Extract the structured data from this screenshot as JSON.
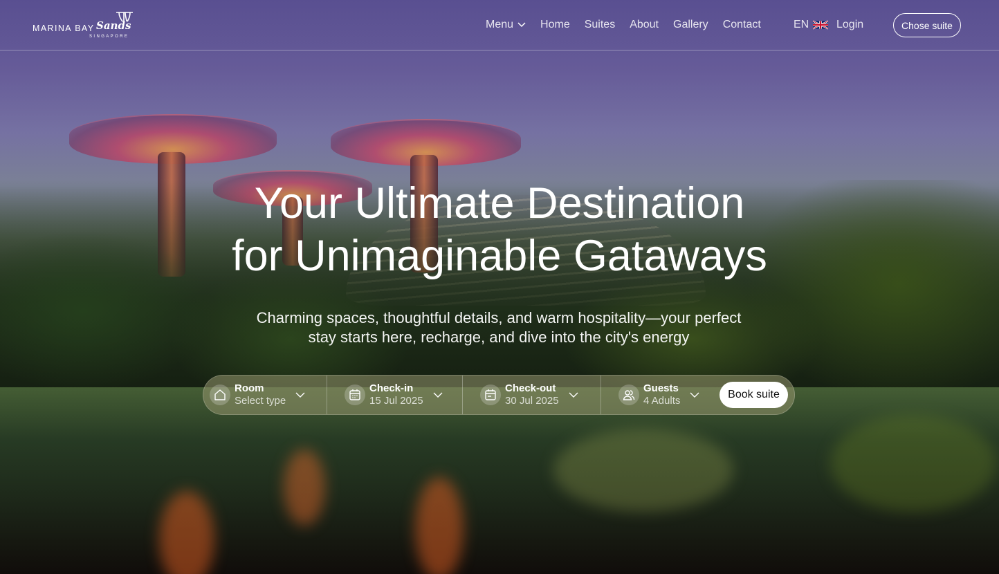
{
  "brand": {
    "name": "MARINA BAY",
    "script": "Sands",
    "location": "SINGAPORE"
  },
  "nav": {
    "items": [
      {
        "label": "Menu",
        "has_dropdown": true
      },
      {
        "label": "Home"
      },
      {
        "label": "Suites"
      },
      {
        "label": "About"
      },
      {
        "label": "Gallery"
      },
      {
        "label": "Contact"
      }
    ],
    "language": "EN",
    "login": "Login",
    "cta": "Chose suite"
  },
  "hero": {
    "title_line1": "Your Ultimate Destination",
    "title_line2": "for Unimaginable Gataways",
    "subtitle_line1": "Charming spaces, thoughtful details, and warm hospitality—your perfect",
    "subtitle_line2": "stay starts here, recharge, and dive into the city's energy"
  },
  "booking": {
    "room": {
      "label": "Room",
      "value": "Select type",
      "icon": "home-icon"
    },
    "checkin": {
      "label": "Check-in",
      "value": "15 Jul 2025",
      "icon": "calendar-icon"
    },
    "checkout": {
      "label": "Check-out",
      "value": "30 Jul 2025",
      "icon": "calendar-icon"
    },
    "guests": {
      "label": "Guests",
      "value": "4 Adults",
      "icon": "users-icon"
    },
    "button": "Book suite"
  },
  "colors": {
    "bar_bg": "#96966e",
    "button_bg": "#ffffff",
    "text": "#ffffff"
  }
}
